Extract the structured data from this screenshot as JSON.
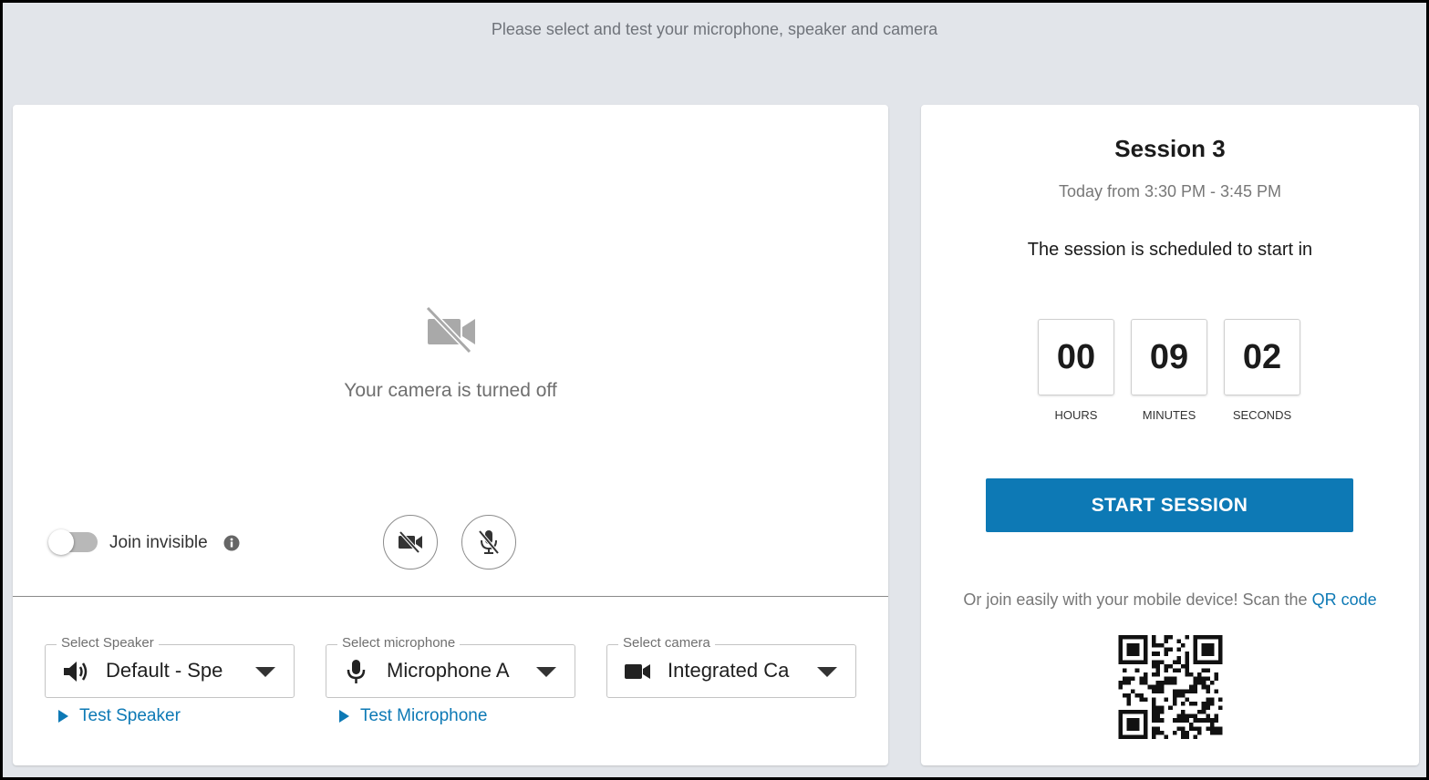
{
  "header": {
    "instruction": "Please select and test your microphone, speaker and camera"
  },
  "preview": {
    "camera_off_text": "Your camera is turned off",
    "join_invisible_label": "Join invisible",
    "join_invisible_on": false
  },
  "devices": {
    "speaker": {
      "legend": "Select Speaker",
      "value": "Default - Spe",
      "test_label": "Test Speaker"
    },
    "microphone": {
      "legend": "Select microphone",
      "value": "Microphone A",
      "test_label": "Test Microphone"
    },
    "camera": {
      "legend": "Select camera",
      "value": "Integrated Ca"
    }
  },
  "session": {
    "title": "Session 3",
    "time": "Today from 3:30 PM - 3:45 PM",
    "scheduled_text": "The session is scheduled to start in",
    "countdown": [
      {
        "value": "00",
        "label": "HOURS"
      },
      {
        "value": "09",
        "label": "MINUTES"
      },
      {
        "value": "02",
        "label": "SECONDS"
      }
    ],
    "start_button": "START SESSION",
    "qr_text": "Or join easily with your mobile device! Scan the",
    "qr_link": "QR code"
  },
  "colors": {
    "accent": "#0d79b5",
    "background": "#e2e5ea"
  }
}
